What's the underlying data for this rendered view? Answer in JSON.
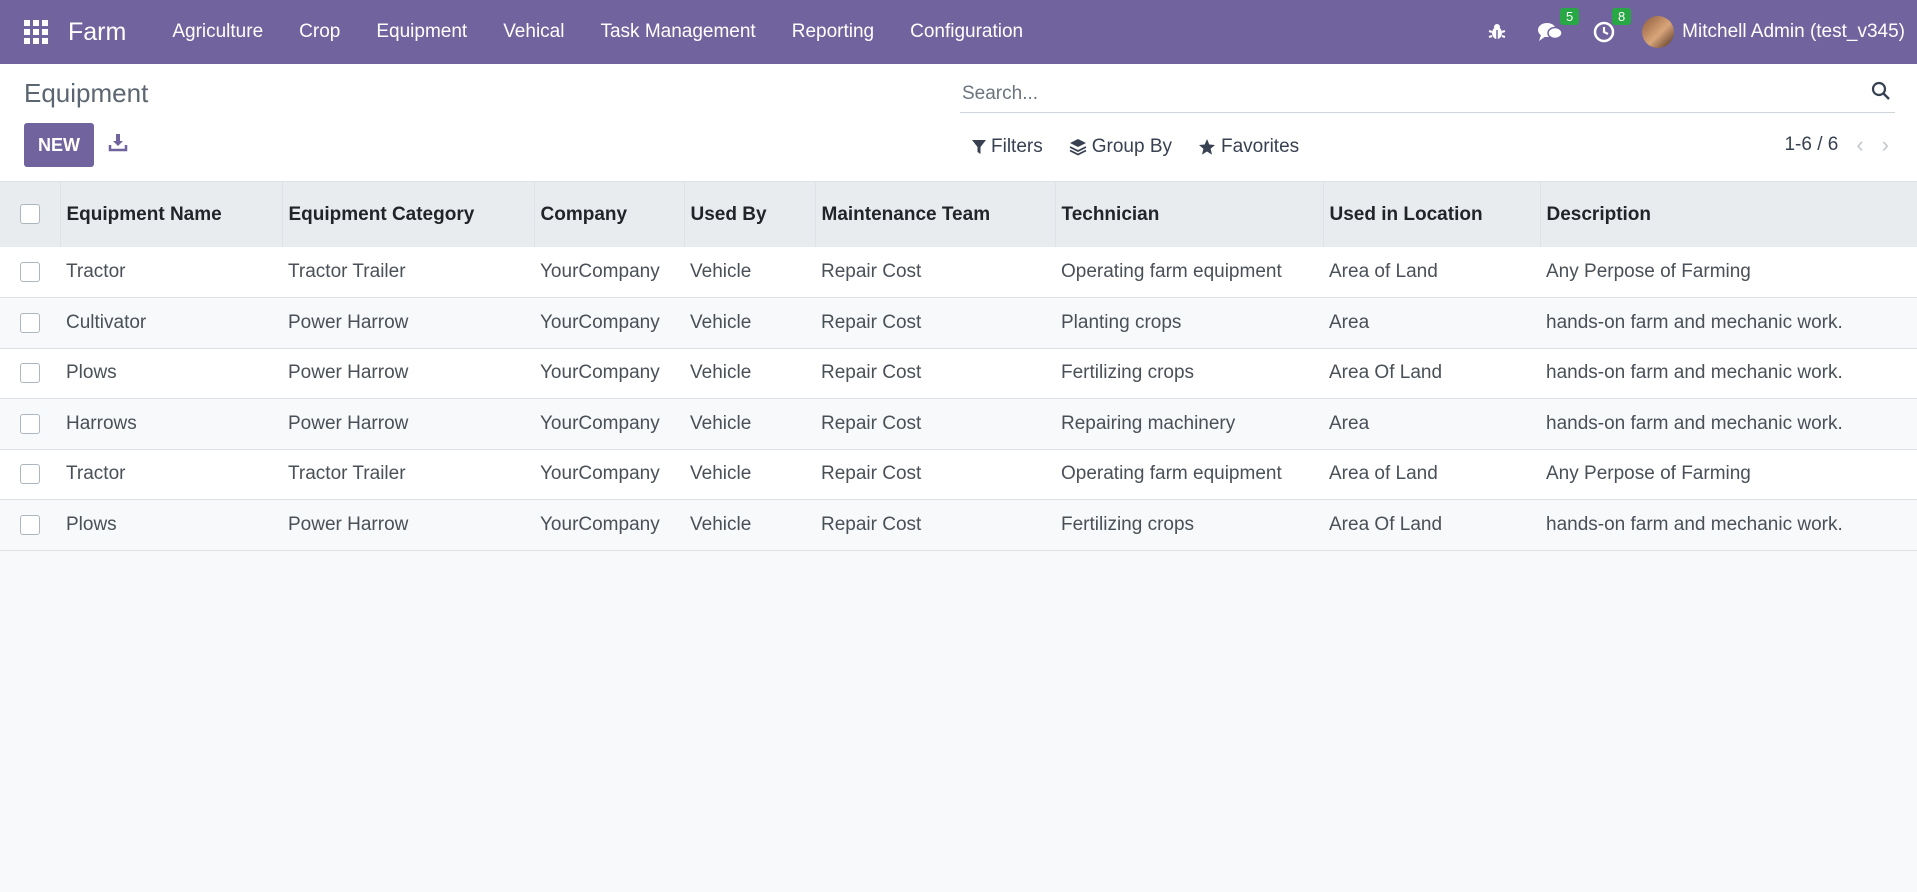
{
  "navbar": {
    "brand": "Farm",
    "menu": [
      "Agriculture",
      "Crop",
      "Equipment",
      "Vehical",
      "Task Management",
      "Reporting",
      "Configuration"
    ],
    "messages_count": "5",
    "activities_count": "8",
    "user": "Mitchell Admin (test_v345)",
    "icons": [
      "apps-grid-icon",
      "bug-icon",
      "chat-icon",
      "clock-icon"
    ]
  },
  "control_panel": {
    "title": "Equipment",
    "new_label": "NEW",
    "search_placeholder": "Search...",
    "filters_label": "Filters",
    "group_by_label": "Group By",
    "favorites_label": "Favorites",
    "pager": "1-6 / 6"
  },
  "table": {
    "columns": [
      "Equipment Name",
      "Equipment Category",
      "Company",
      "Used By",
      "Maintenance Team",
      "Technician",
      "Used in Location",
      "Description"
    ],
    "rows": [
      [
        "Tractor",
        "Tractor Trailer",
        "YourCompany",
        "Vehicle",
        "Repair Cost",
        "Operating farm equipment",
        "Area of Land",
        "Any Perpose of Farming"
      ],
      [
        "Cultivator",
        "Power Harrow",
        "YourCompany",
        "Vehicle",
        "Repair Cost",
        "Planting crops",
        "Area",
        "hands-on farm and mechanic work."
      ],
      [
        "Plows",
        "Power Harrow",
        "YourCompany",
        "Vehicle",
        "Repair Cost",
        "Fertilizing crops",
        "Area Of Land",
        "hands-on farm and mechanic work."
      ],
      [
        "Harrows",
        "Power Harrow",
        "YourCompany",
        "Vehicle",
        "Repair Cost",
        "Repairing machinery",
        "Area",
        "hands-on farm and mechanic work."
      ],
      [
        "Tractor",
        "Tractor Trailer",
        "YourCompany",
        "Vehicle",
        "Repair Cost",
        "Operating farm equipment",
        "Area of Land",
        "Any Perpose of Farming"
      ],
      [
        "Plows",
        "Power Harrow",
        "YourCompany",
        "Vehicle",
        "Repair Cost",
        "Fertilizing crops",
        "Area Of Land",
        "hands-on farm and mechanic work."
      ]
    ]
  },
  "colors": {
    "brand": "#71639e",
    "badge": "#28a745"
  }
}
